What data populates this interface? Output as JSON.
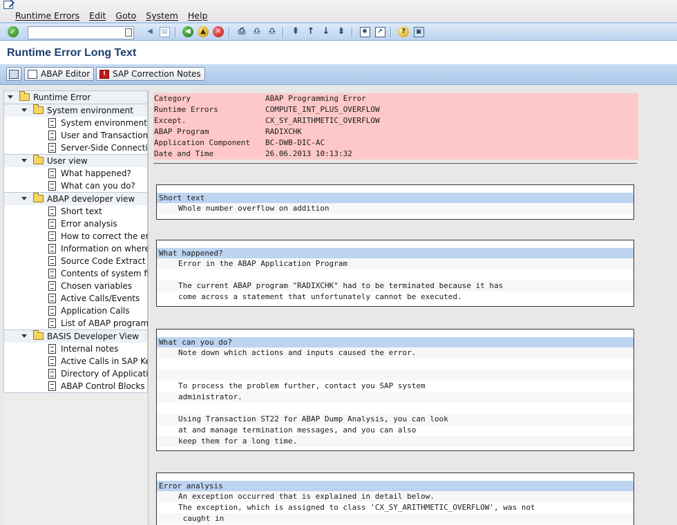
{
  "menu": [
    "Runtime Errors",
    "Edit",
    "Goto",
    "System",
    "Help"
  ],
  "command_field": {
    "value": ""
  },
  "title": "Runtime Error Long Text",
  "app_toolbar": {
    "abap_editor": "ABAP Editor",
    "correction_notes": "SAP Correction Notes"
  },
  "tree": {
    "root": "Runtime Error",
    "sections": [
      {
        "label": "System environment",
        "items": [
          "System environment",
          "User and Transaction",
          "Server-Side Connection"
        ]
      },
      {
        "label": "User view",
        "items": [
          "What happened?",
          "What can you do?"
        ]
      },
      {
        "label": "ABAP developer view",
        "items": [
          "Short text",
          "Error analysis",
          "How to correct the err",
          "Information on where t",
          "Source Code Extract",
          "Contents of system fiel",
          "Chosen variables",
          "Active Calls/Events",
          "Application Calls",
          "List of ABAP programs a"
        ]
      },
      {
        "label": "BASIS Developer View",
        "items": [
          "Internal notes",
          "Active Calls in SAP Kern",
          "Directory of Application",
          "ABAP Control Blocks (C"
        ]
      }
    ]
  },
  "header_fields": [
    {
      "key": "Category",
      "value": "ABAP Programming Error"
    },
    {
      "key": "Runtime Errors",
      "value": "COMPUTE_INT_PLUS_OVERFLOW"
    },
    {
      "key": "Except.",
      "value": "CX_SY_ARITHMETIC_OVERFLOW"
    },
    {
      "key": "ABAP Program",
      "value": "RADIXCHK"
    },
    {
      "key": "Application Component",
      "value": "BC-DWB-DIC-AC"
    },
    {
      "key": "Date and Time",
      "value": "26.06.2013 10:13:32"
    }
  ],
  "boxes": {
    "short_text": {
      "title": "Short text",
      "lines": [
        "Whole number overflow on addition"
      ]
    },
    "what_happened": {
      "title": "What happened?",
      "lines": [
        "Error in the ABAP Application Program",
        "",
        "The current ABAP program \"RADIXCHK\" had to be terminated because it has",
        "come across a statement that unfortunately cannot be executed."
      ]
    },
    "what_can_you_do": {
      "title": "What can you do?",
      "lines": [
        "Note down which actions and inputs caused the error.",
        "",
        "",
        "To process the problem further, contact you SAP system",
        "administrator.",
        "",
        "Using Transaction ST22 for ABAP Dump Analysis, you can look",
        "at and manage termination messages, and you can also",
        "keep them for a long time."
      ]
    },
    "error_analysis": {
      "title": "Error analysis",
      "lines": [
        "An exception occurred that is explained in detail below.",
        "The exception, which is assigned to class 'CX_SY_ARITHMETIC_OVERFLOW', was not",
        " caught in"
      ]
    }
  }
}
